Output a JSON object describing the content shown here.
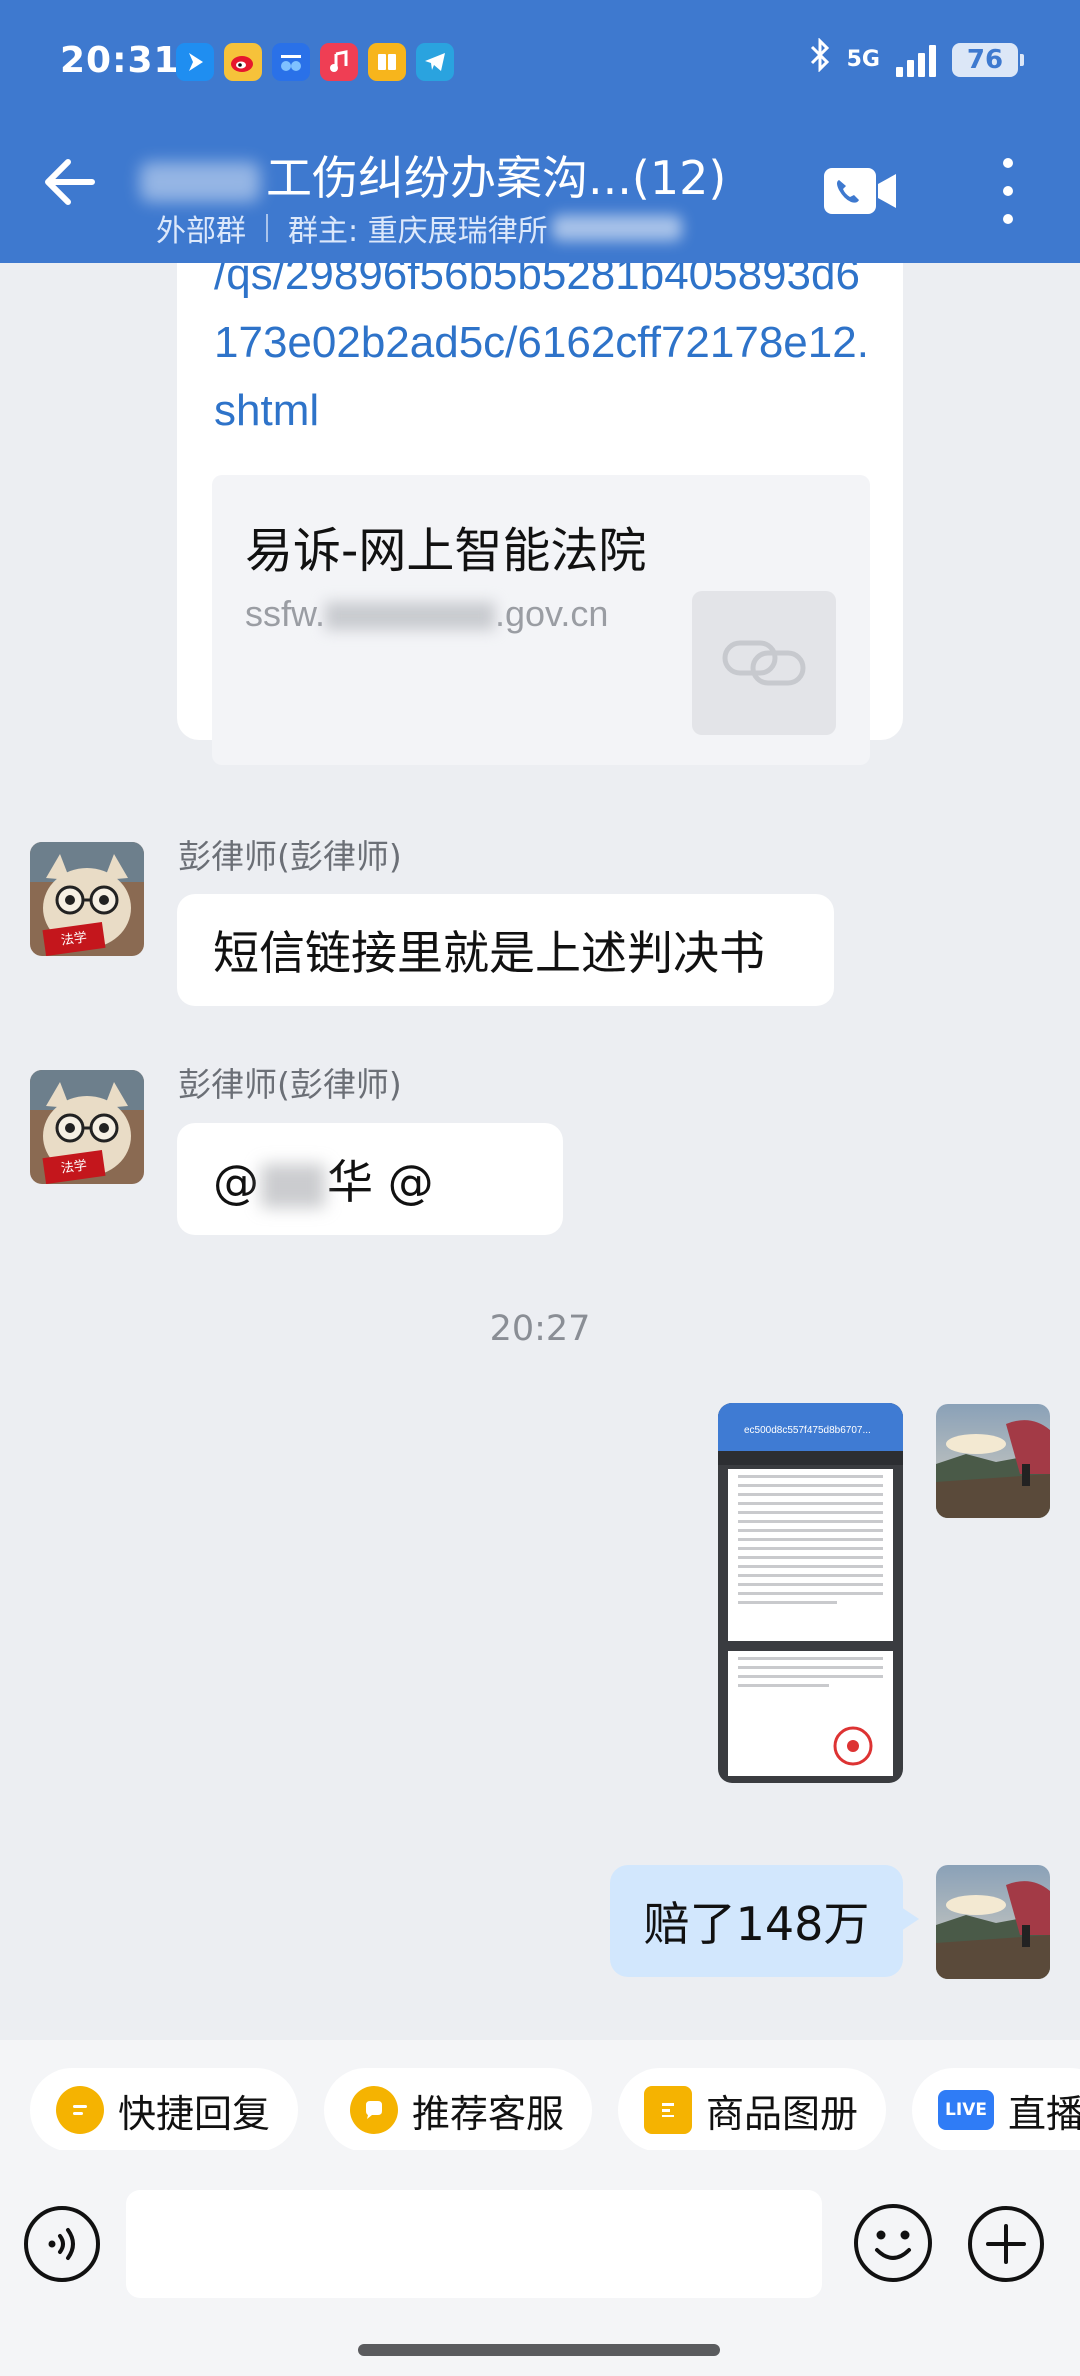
{
  "status_bar": {
    "time": "20:31",
    "network": "5G",
    "battery": "76",
    "app_icons": [
      "blue-arrow-app-icon",
      "weibo-icon",
      "autohome-icon",
      "music-icon",
      "books-icon",
      "telegram-icon"
    ]
  },
  "header": {
    "title": "工伤纠纷办案沟...(12)",
    "group_type": "外部群",
    "owner": "群主: 重庆展瑞律所",
    "background_color": "#3e79cf"
  },
  "messages": {
    "link": {
      "url_text": "/qs/29896f56b5b5281b405893d6173e02b2ad5c/6162cff72178e12.shtml",
      "card_title": "易诉-网上智能法院",
      "card_domain_start": "ssfw.",
      "card_domain_end": ".gov.cn"
    },
    "msg1": {
      "sender": "彭律师(彭律师)",
      "text": "短信链接里就是上述判决书"
    },
    "msg2": {
      "sender": "彭律师(彭律师)",
      "text_start": "@",
      "text_mid": "华",
      "text_end": " @"
    },
    "timestamp": "20:27",
    "image_msg": {
      "doc_title": "ec500d8c557f475d8b6707..."
    },
    "msg3": {
      "text": "赔了148万"
    }
  },
  "quick_replies": [
    {
      "label": "快捷回复",
      "icon": "quick-reply-icon",
      "color": "#f5b301"
    },
    {
      "label": "推荐客服",
      "icon": "chat-bubble-icon",
      "color": "#f5b301"
    },
    {
      "label": "商品图册",
      "icon": "catalog-icon",
      "color": "#f5b301"
    },
    {
      "label": "直播",
      "icon": "live-icon",
      "color": "#2f7cf6"
    }
  ],
  "composer": {
    "placeholder": ""
  }
}
